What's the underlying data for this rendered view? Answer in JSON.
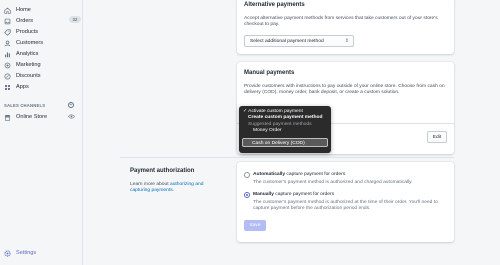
{
  "sidebar": {
    "items": [
      {
        "label": "Home",
        "icon": "home-icon"
      },
      {
        "label": "Orders",
        "icon": "orders-icon",
        "badge": "32"
      },
      {
        "label": "Products",
        "icon": "products-icon"
      },
      {
        "label": "Customers",
        "icon": "customers-icon"
      },
      {
        "label": "Analytics",
        "icon": "analytics-icon"
      },
      {
        "label": "Marketing",
        "icon": "marketing-icon"
      },
      {
        "label": "Discounts",
        "icon": "discounts-icon"
      },
      {
        "label": "Apps",
        "icon": "apps-icon"
      }
    ],
    "sales_channels_label": "SALES CHANNELS",
    "online_store_label": "Online Store",
    "settings_label": "Settings"
  },
  "alternative": {
    "title": "Alternative payments",
    "description": "Accept alternative payment methods from services that take customers out of your store's checkout to pay.",
    "select_label": "Select additional payment method"
  },
  "manual": {
    "title": "Manual payments",
    "description": "Provide customers with instructions to pay outside of your online store. Choose from cash on delivery (COD), money order, bank deposit, or create a custom solution.",
    "edit_label": "Edit"
  },
  "dropdown": {
    "options": [
      {
        "label": "✓ Activate custom payment",
        "style": "normal"
      },
      {
        "label": "Create custom payment method",
        "style": "bold"
      },
      {
        "label": "Suggested payment methods",
        "style": "muted"
      },
      {
        "label": "Money Order",
        "style": "indent"
      }
    ],
    "highlighted": "Cash on Delivery (COD)"
  },
  "authorization": {
    "title": "Payment authorization",
    "description": "Learn more about authorizing and capturing payments.",
    "link_text": "authorizing and capturing payments",
    "option_auto_strong": "Automatically",
    "option_auto_rest": " capture payment for orders",
    "option_auto_help": "The customer's payment method is authorized and charged automatically.",
    "option_manual_strong": "Manually",
    "option_manual_rest": " capture payment for orders",
    "option_manual_help": "The customer's payment method is authorized at the time of their order. You'll need to capture payment before the authorization period ends.",
    "selected": "manual",
    "save_label": "Save"
  },
  "colors": {
    "accent": "#5c6ac4",
    "link": "#006fbb",
    "save_disabled": "#b3bcf5"
  }
}
